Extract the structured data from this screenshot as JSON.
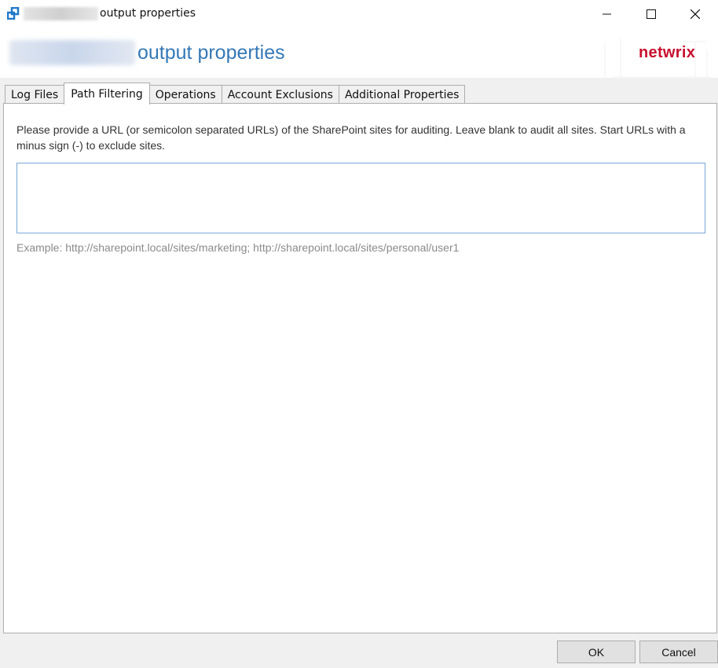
{
  "window": {
    "title_suffix": "output properties",
    "controls": {
      "minimize": "minimize",
      "maximize": "maximize",
      "close": "close"
    }
  },
  "header": {
    "title": "output properties",
    "logo": "netwrix"
  },
  "tabs": [
    {
      "label": "Log Files",
      "active": false
    },
    {
      "label": "Path Filtering",
      "active": true
    },
    {
      "label": "Operations",
      "active": false
    },
    {
      "label": "Account Exclusions",
      "active": false
    },
    {
      "label": "Additional Properties",
      "active": false
    }
  ],
  "path_filtering": {
    "description": "Please provide a URL (or semicolon separated URLs) of the SharePoint sites for auditing. Leave blank to audit all sites. Start URLs with a minus sign (-) to exclude sites.",
    "input_value": "",
    "example": "Example: http://sharepoint.local/sites/marketing; http://sharepoint.local/sites/personal/user1"
  },
  "footer": {
    "ok_label": "OK",
    "cancel_label": "Cancel"
  },
  "colors": {
    "header_title": "#3478b6",
    "logo": "#c8102e",
    "input_border": "#7aa7d6"
  }
}
